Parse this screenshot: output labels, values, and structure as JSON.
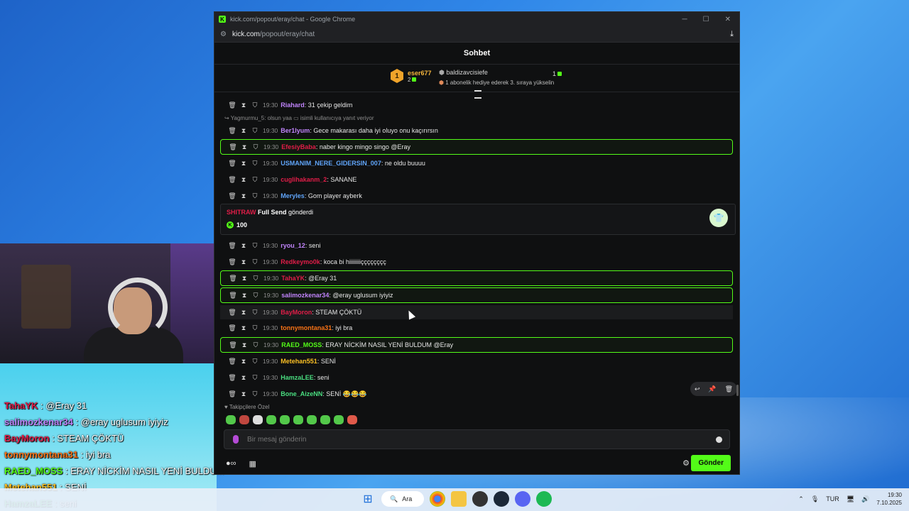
{
  "window": {
    "title": "kick.com/popout/eray/chat - Google Chrome",
    "url_host": "kick.com",
    "url_path": "/popout/eray/chat"
  },
  "chat": {
    "header": "Sohbet",
    "top_gifter": {
      "rank": "1",
      "name": "eser677",
      "count": "2"
    },
    "second_gifter": {
      "name": "baldizavcisiefe",
      "count": "1",
      "hint": "1 abonelik hediye ederek 3. sıraya yükselin"
    },
    "reply_hint": "Yagmurmu_5: olsun yaa",
    "reply_hint_suffix": "isimli kullanıcıya yanıt veriyor",
    "messages": [
      {
        "time": "19:30",
        "user": "Riahard",
        "color": "#c084fc",
        "text": ": 31 çekip geldim",
        "hl": false
      },
      {
        "time": "19:30",
        "user": "Ber1lyum",
        "color": "#c084fc",
        "text": ": Gece makarası daha iyi oluyo onu kaçırırsın",
        "hl": false
      },
      {
        "time": "19:30",
        "user": "EfesiyBaba",
        "color": "#e11d48",
        "text": ": naber kingo mingo singo @Eray",
        "hl": true
      },
      {
        "time": "19:30",
        "user": "USMANIM_NERE_GIDERSIN_007",
        "color": "#60a5fa",
        "text": ": ne oldu buuuu",
        "hl": false
      },
      {
        "time": "19:30",
        "user": "cuglihakanm_2",
        "color": "#e11d48",
        "text": ": SANANE",
        "hl": false
      },
      {
        "time": "19:30",
        "user": "Meryles",
        "color": "#60a5fa",
        "text": ": Gom player ayberk",
        "hl": false
      },
      {
        "time": "19:30",
        "user": "ryou_12",
        "color": "#c084fc",
        "text": ": seni",
        "hl": false
      },
      {
        "time": "19:30",
        "user": "Redkeymo0k",
        "color": "#e11d48",
        "text": ": koca bi hiiiiiiiiçççççççç",
        "hl": false
      },
      {
        "time": "19:30",
        "user": "TahaYK",
        "color": "#e11d48",
        "text": ": @Eray 31",
        "hl": true
      },
      {
        "time": "19:30",
        "user": "salimozkenar34",
        "color": "#c084fc",
        "text": ": @eray uglusum iyiyiz",
        "hl": true
      },
      {
        "time": "19:30",
        "user": "BayMoron",
        "color": "#e11d48",
        "text": ": STEAM ÇÖKTÜ",
        "hl": false
      },
      {
        "time": "19:30",
        "user": "tonnymontana31",
        "color": "#f97316",
        "text": ": iyi bra",
        "hl": false
      },
      {
        "time": "19:30",
        "user": "RAED_MOSS",
        "color": "#53fc18",
        "text": ": ERAY NİCKİM NASIL YENİ BULDUM @Eray",
        "hl": true
      },
      {
        "time": "19:30",
        "user": "Metehan551",
        "color": "#fbbf24",
        "text": ": SENİ",
        "hl": false
      },
      {
        "time": "19:30",
        "user": "HamzaLEE",
        "color": "#4ade80",
        "text": ": seni",
        "hl": false
      },
      {
        "time": "19:30",
        "user": "Bone_AizeNN",
        "color": "#4ade80",
        "text": ": SENİ 😂😂😂",
        "hl": false
      }
    ],
    "gift": {
      "user": "SHITRAW",
      "item": "Full Send",
      "verb": "gönderdi",
      "amount": "100"
    },
    "emote_label": "Takipçilere Özel",
    "input_placeholder": "Bir mesaj gönderin",
    "send_label": "Gönder"
  },
  "overlay": [
    {
      "user": "TahaYK",
      "color": "#e11d48",
      "text": " : @Eray 31"
    },
    {
      "user": "salimozkenar34",
      "color": "#c084fc",
      "text": " : @eray uglusum iyiyiz"
    },
    {
      "user": "BayMoron",
      "color": "#e11d48",
      "text": " : STEAM ÇÖKTÜ"
    },
    {
      "user": "tonnymontana31",
      "color": "#f97316",
      "text": " : iyi bra"
    },
    {
      "user": "RAED_MOSS",
      "color": "#53fc18",
      "text": " : ERAY NİCKİM NASIL YENİ BULDUM"
    },
    {
      "user": "Metehan551",
      "color": "#fbbf24",
      "text": " : SENİ"
    },
    {
      "user": "HamzaLEE",
      "color": "#4ade80",
      "text": " : seni"
    }
  ],
  "taskbar": {
    "search": "Ara",
    "lang": "TUR",
    "time": "19:30",
    "date": "7.10.2025"
  }
}
